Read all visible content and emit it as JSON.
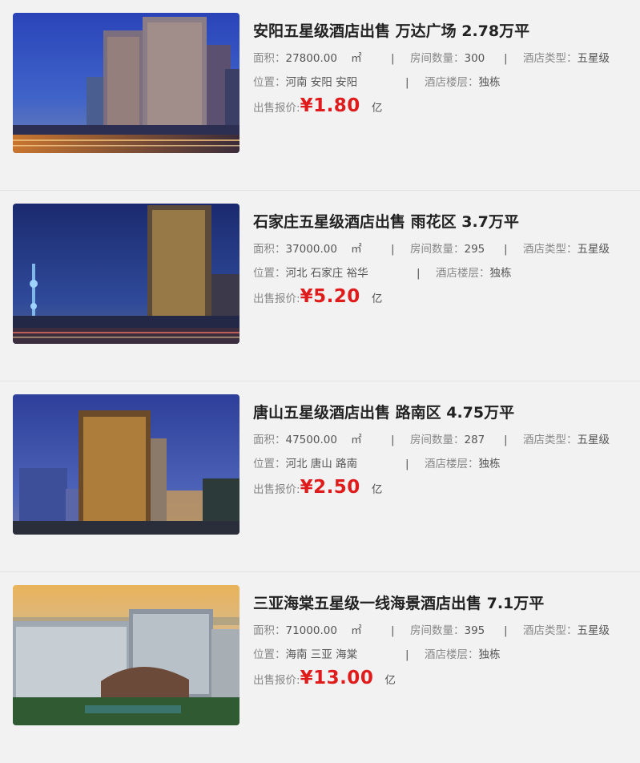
{
  "labels": {
    "area": "面积：",
    "area_unit": "㎡",
    "rooms": "房间数量：",
    "type": "酒店类型：",
    "location": "位置：",
    "floors": "酒店楼层：",
    "price": "出售报价:",
    "price_unit": "亿",
    "separator": "|"
  },
  "listings": [
    {
      "title": "安阳五星级酒店出售 万达广场 2.78万平",
      "area": "27800.00",
      "rooms": "300",
      "type": "五星级",
      "location": "河南 安阳 安阳",
      "floors": "独栋",
      "price": "¥1.80"
    },
    {
      "title": "石家庄五星级酒店出售 雨花区 3.7万平",
      "area": "37000.00",
      "rooms": "295",
      "type": "五星级",
      "location": "河北 石家庄 裕华",
      "floors": "独栋",
      "price": "¥5.20"
    },
    {
      "title": "唐山五星级酒店出售 路南区 4.75万平",
      "area": "47500.00",
      "rooms": "287",
      "type": "五星级",
      "location": "河北 唐山 路南",
      "floors": "独栋",
      "price": "¥2.50"
    },
    {
      "title": "三亚海棠五星级一线海景酒店出售 7.1万平",
      "area": "71000.00",
      "rooms": "395",
      "type": "五星级",
      "location": "海南 三亚 海棠",
      "floors": "独栋",
      "price": "¥13.00"
    }
  ]
}
